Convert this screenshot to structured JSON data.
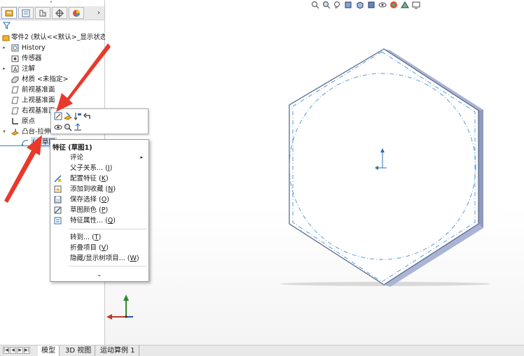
{
  "feature_tree": {
    "tabs": [
      {
        "name": "feature-manager",
        "icon": "feature-manager-icon"
      },
      {
        "name": "property-manager",
        "icon": "property-manager-icon"
      },
      {
        "name": "configuration-manager",
        "icon": "configuration-manager-icon"
      },
      {
        "name": "dim-xpert",
        "icon": "dimxpert-icon"
      },
      {
        "name": "display-manager",
        "icon": "display-manager-icon"
      }
    ],
    "more_glyph": "›",
    "part_label": "零件2 (默认<<默认>_显示状态",
    "items": [
      {
        "label": "History",
        "icon": "history-icon",
        "expander": "▸"
      },
      {
        "label": "传感器",
        "icon": "sensor-icon",
        "expander": ""
      },
      {
        "label": "注解",
        "icon": "annotation-icon",
        "expander": "▸"
      },
      {
        "label": "材质 <未指定>",
        "icon": "material-icon",
        "expander": ""
      },
      {
        "label": "前视基准面",
        "icon": "plane-icon",
        "expander": ""
      },
      {
        "label": "上视基准面",
        "icon": "plane-icon",
        "expander": ""
      },
      {
        "label": "右视基准面",
        "icon": "plane-icon",
        "expander": ""
      },
      {
        "label": "原点",
        "icon": "origin-icon",
        "expander": ""
      },
      {
        "label": "凸台-拉伸",
        "icon": "extrude-icon",
        "expander": "▾"
      },
      {
        "label": "(-) 草图",
        "icon": "sketch-icon",
        "expander": ""
      }
    ]
  },
  "context_menu": {
    "title": "特征 (草图1)",
    "items": [
      {
        "label": "评论",
        "icon": "",
        "has_submenu": true
      },
      {
        "label": "父子关系...",
        "shortcut": "J",
        "icon": ""
      },
      {
        "label": "配置特征",
        "shortcut": "K",
        "icon": "configure-feature-icon"
      },
      {
        "label": "添加到收藏",
        "shortcut": "N",
        "icon": "favorite-icon"
      },
      {
        "label": "保存选择",
        "shortcut": "O",
        "icon": "save-selection-icon"
      },
      {
        "label": "草图颜色",
        "shortcut": "P",
        "icon": "sketch-color-icon"
      },
      {
        "label": "特征属性...",
        "shortcut": "Q",
        "icon": "feature-properties-icon"
      },
      {
        "label": "转到...",
        "shortcut": "T",
        "icon": ""
      },
      {
        "label": "折叠项目",
        "shortcut": "V",
        "icon": ""
      },
      {
        "label": "隐藏/显示树项目...",
        "shortcut": "W",
        "icon": ""
      }
    ],
    "more_glyph": "⌄"
  },
  "context_toolbar": {
    "row1": [
      "edit-sketch-icon",
      "edit-feature-icon",
      "rollback-icon",
      "undo-icon"
    ],
    "row2": [
      "hide-show-icon",
      "zoom-to-selection-icon",
      "normal-to-icon"
    ]
  },
  "bottom_tabs": [
    "模型",
    "3D 视图",
    "运动算例 1"
  ],
  "nav_glyphs": [
    "|◀",
    "◀",
    "▶",
    "▶|"
  ],
  "colors": {
    "accent_blue": "#3b7bd1",
    "red_arrow": "#e8392b",
    "hex_edge": "#5b6a8a",
    "hex_side": "#9aa6c8",
    "sketch_circle": "#4a90d9"
  }
}
